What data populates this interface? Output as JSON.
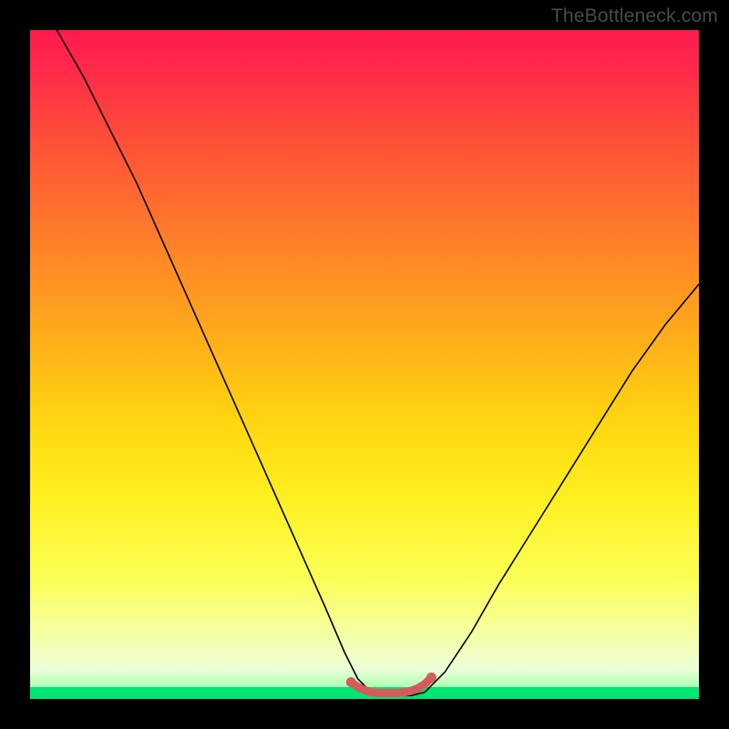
{
  "watermark": {
    "text": "TheBottleneck.com"
  },
  "chart_data": {
    "type": "line",
    "xlabel": "",
    "ylabel": "",
    "title": "",
    "x_range": [
      0,
      100
    ],
    "y_range": [
      0,
      100
    ],
    "series": [
      {
        "name": "bottleneck-curve",
        "color": "#000000",
        "x": [
          4,
          8,
          12,
          16,
          20,
          24,
          28,
          32,
          36,
          40,
          44,
          47,
          49,
          51,
          53,
          55,
          57,
          59,
          62,
          66,
          70,
          75,
          80,
          85,
          90,
          95,
          100
        ],
        "y": [
          100,
          93,
          85,
          77,
          68,
          59,
          50,
          41,
          32,
          23,
          14,
          7,
          3,
          1,
          0.5,
          0.5,
          0.5,
          1,
          4,
          10,
          17,
          25,
          33,
          41,
          49,
          56,
          62
        ]
      },
      {
        "name": "bottom-marker",
        "color": "#d75a5a",
        "x": [
          48,
          49,
          50,
          51,
          52,
          53,
          54,
          55,
          56,
          57,
          58,
          59,
          60
        ],
        "y": [
          2.5,
          1.8,
          1.3,
          1.0,
          0.9,
          0.9,
          0.9,
          0.9,
          1.0,
          1.2,
          1.6,
          2.2,
          3.2
        ]
      }
    ],
    "background_gradient": {
      "stops": [
        {
          "pos": 0.0,
          "color": "#ff1a4d"
        },
        {
          "pos": 0.06,
          "color": "#ff2a4a"
        },
        {
          "pos": 0.15,
          "color": "#ff4a3a"
        },
        {
          "pos": 0.3,
          "color": "#ff7a2a"
        },
        {
          "pos": 0.45,
          "color": "#ffaa1a"
        },
        {
          "pos": 0.58,
          "color": "#ffd410"
        },
        {
          "pos": 0.7,
          "color": "#fff020"
        },
        {
          "pos": 0.82,
          "color": "#fbff55"
        },
        {
          "pos": 0.9,
          "color": "#f5ffa0"
        },
        {
          "pos": 0.955,
          "color": "#ecffd8"
        },
        {
          "pos": 0.985,
          "color": "#a8ffb0"
        },
        {
          "pos": 1.0,
          "color": "#00e676"
        }
      ]
    },
    "green_band_height_pct": 1.8
  }
}
